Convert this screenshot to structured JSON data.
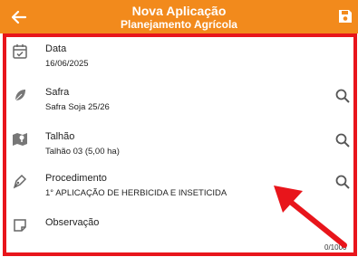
{
  "header": {
    "title": "Nova Aplicação",
    "subtitle": "Planejamento Agrícola",
    "back_icon": "arrow-left-icon",
    "save_icon": "save-disk-icon",
    "background_color": "#f28a1c"
  },
  "fields": [
    {
      "label": "Data",
      "value": "16/06/2025",
      "icon": "calendar-check-icon"
    },
    {
      "label": "Safra",
      "value": "Safra Soja 25/26",
      "icon": "leaf-icon"
    },
    {
      "label": "Talhão",
      "value": "Talhão 03 (5,00 ha)",
      "icon": "map-pin-icon"
    },
    {
      "label": "Procedimento",
      "value": "1° APLICAÇÃO DE HERBICIDA E INSETICIDA",
      "icon": "pen-nib-icon"
    },
    {
      "label": "Observação",
      "value": "",
      "icon": "note-icon"
    }
  ],
  "observation_counter": "0/1000",
  "highlight_color": "#e8151b"
}
